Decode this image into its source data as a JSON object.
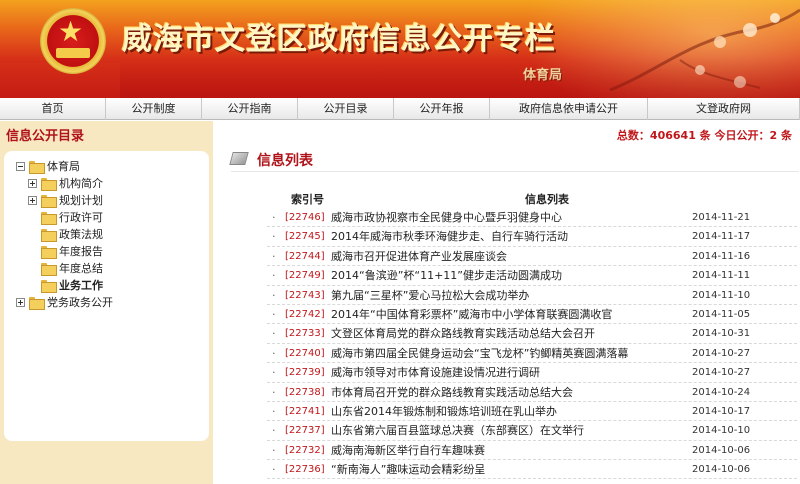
{
  "header": {
    "title": "威海市文登区政府信息公开专栏",
    "department": "体育局"
  },
  "nav": {
    "items": [
      {
        "label": "首页",
        "width": 106
      },
      {
        "label": "公开制度",
        "width": 96
      },
      {
        "label": "公开指南",
        "width": 96
      },
      {
        "label": "公开目录",
        "width": 96
      },
      {
        "label": "公开年报",
        "width": 96
      },
      {
        "label": "政府信息依申请公开",
        "width": 158
      },
      {
        "label": "文登政府网",
        "width": 152
      }
    ]
  },
  "sidebar": {
    "title": "信息公开目录",
    "tree": [
      {
        "label": "体育局",
        "level": 0,
        "expander": "minus",
        "bold": false
      },
      {
        "label": "机构简介",
        "level": 1,
        "expander": "plus",
        "bold": false
      },
      {
        "label": "规划计划",
        "level": 1,
        "expander": "plus",
        "bold": false
      },
      {
        "label": "行政许可",
        "level": 1,
        "expander": "none",
        "bold": false
      },
      {
        "label": "政策法规",
        "level": 1,
        "expander": "none",
        "bold": false
      },
      {
        "label": "年度报告",
        "level": 1,
        "expander": "none",
        "bold": false
      },
      {
        "label": "年度总结",
        "level": 1,
        "expander": "none",
        "bold": false
      },
      {
        "label": "业务工作",
        "level": 1,
        "expander": "none",
        "bold": true
      },
      {
        "label": "党务政务公开",
        "level": 0,
        "expander": "plus",
        "bold": false
      }
    ]
  },
  "main": {
    "stats": "总数：406641 条  今日公开：2 条",
    "section_title": "信息列表",
    "columns": {
      "index": "索引号",
      "title": "信息列表"
    },
    "rows": [
      {
        "index": "[22746]",
        "title": "威海市政协视察市全民健身中心暨乒羽健身中心",
        "date": "2014-11-21"
      },
      {
        "index": "[22745]",
        "title": "2014年威海市秋季环海健步走、自行车骑行活动",
        "date": "2014-11-17"
      },
      {
        "index": "[22744]",
        "title": "威海市召开促进体育产业发展座谈会",
        "date": "2014-11-16"
      },
      {
        "index": "[22749]",
        "title": "2014“鲁滨逊”杯“11+11”健步走活动圆满成功",
        "date": "2014-11-11"
      },
      {
        "index": "[22743]",
        "title": "第九届“三星杯”爱心马拉松大会成功举办",
        "date": "2014-11-10"
      },
      {
        "index": "[22742]",
        "title": "2014年“中国体育彩票杯”威海市中小学体育联赛圆满收官",
        "date": "2014-11-05"
      },
      {
        "index": "[22733]",
        "title": "文登区体育局党的群众路线教育实践活动总结大会召开",
        "date": "2014-10-31"
      },
      {
        "index": "[22740]",
        "title": "威海市第四届全民健身运动会“宝飞龙杯”钓鲫精英赛圆满落幕",
        "date": "2014-10-27"
      },
      {
        "index": "[22739]",
        "title": "威海市领导对市体育设施建设情况进行调研",
        "date": "2014-10-27"
      },
      {
        "index": "[22738]",
        "title": "市体育局召开党的群众路线教育实践活动总结大会",
        "date": "2014-10-24"
      },
      {
        "index": "[22741]",
        "title": "山东省2014年锻炼制和锻炼培训班在乳山举办",
        "date": "2014-10-17"
      },
      {
        "index": "[22737]",
        "title": "山东省第六届百县篮球总决赛（东部赛区）在文举行",
        "date": "2014-10-10"
      },
      {
        "index": "[22732]",
        "title": "威海南海新区举行自行车趣味赛",
        "date": "2014-10-06"
      },
      {
        "index": "[22736]",
        "title": "“新南海人”趣味运动会精彩纷呈",
        "date": "2014-10-06"
      }
    ]
  }
}
